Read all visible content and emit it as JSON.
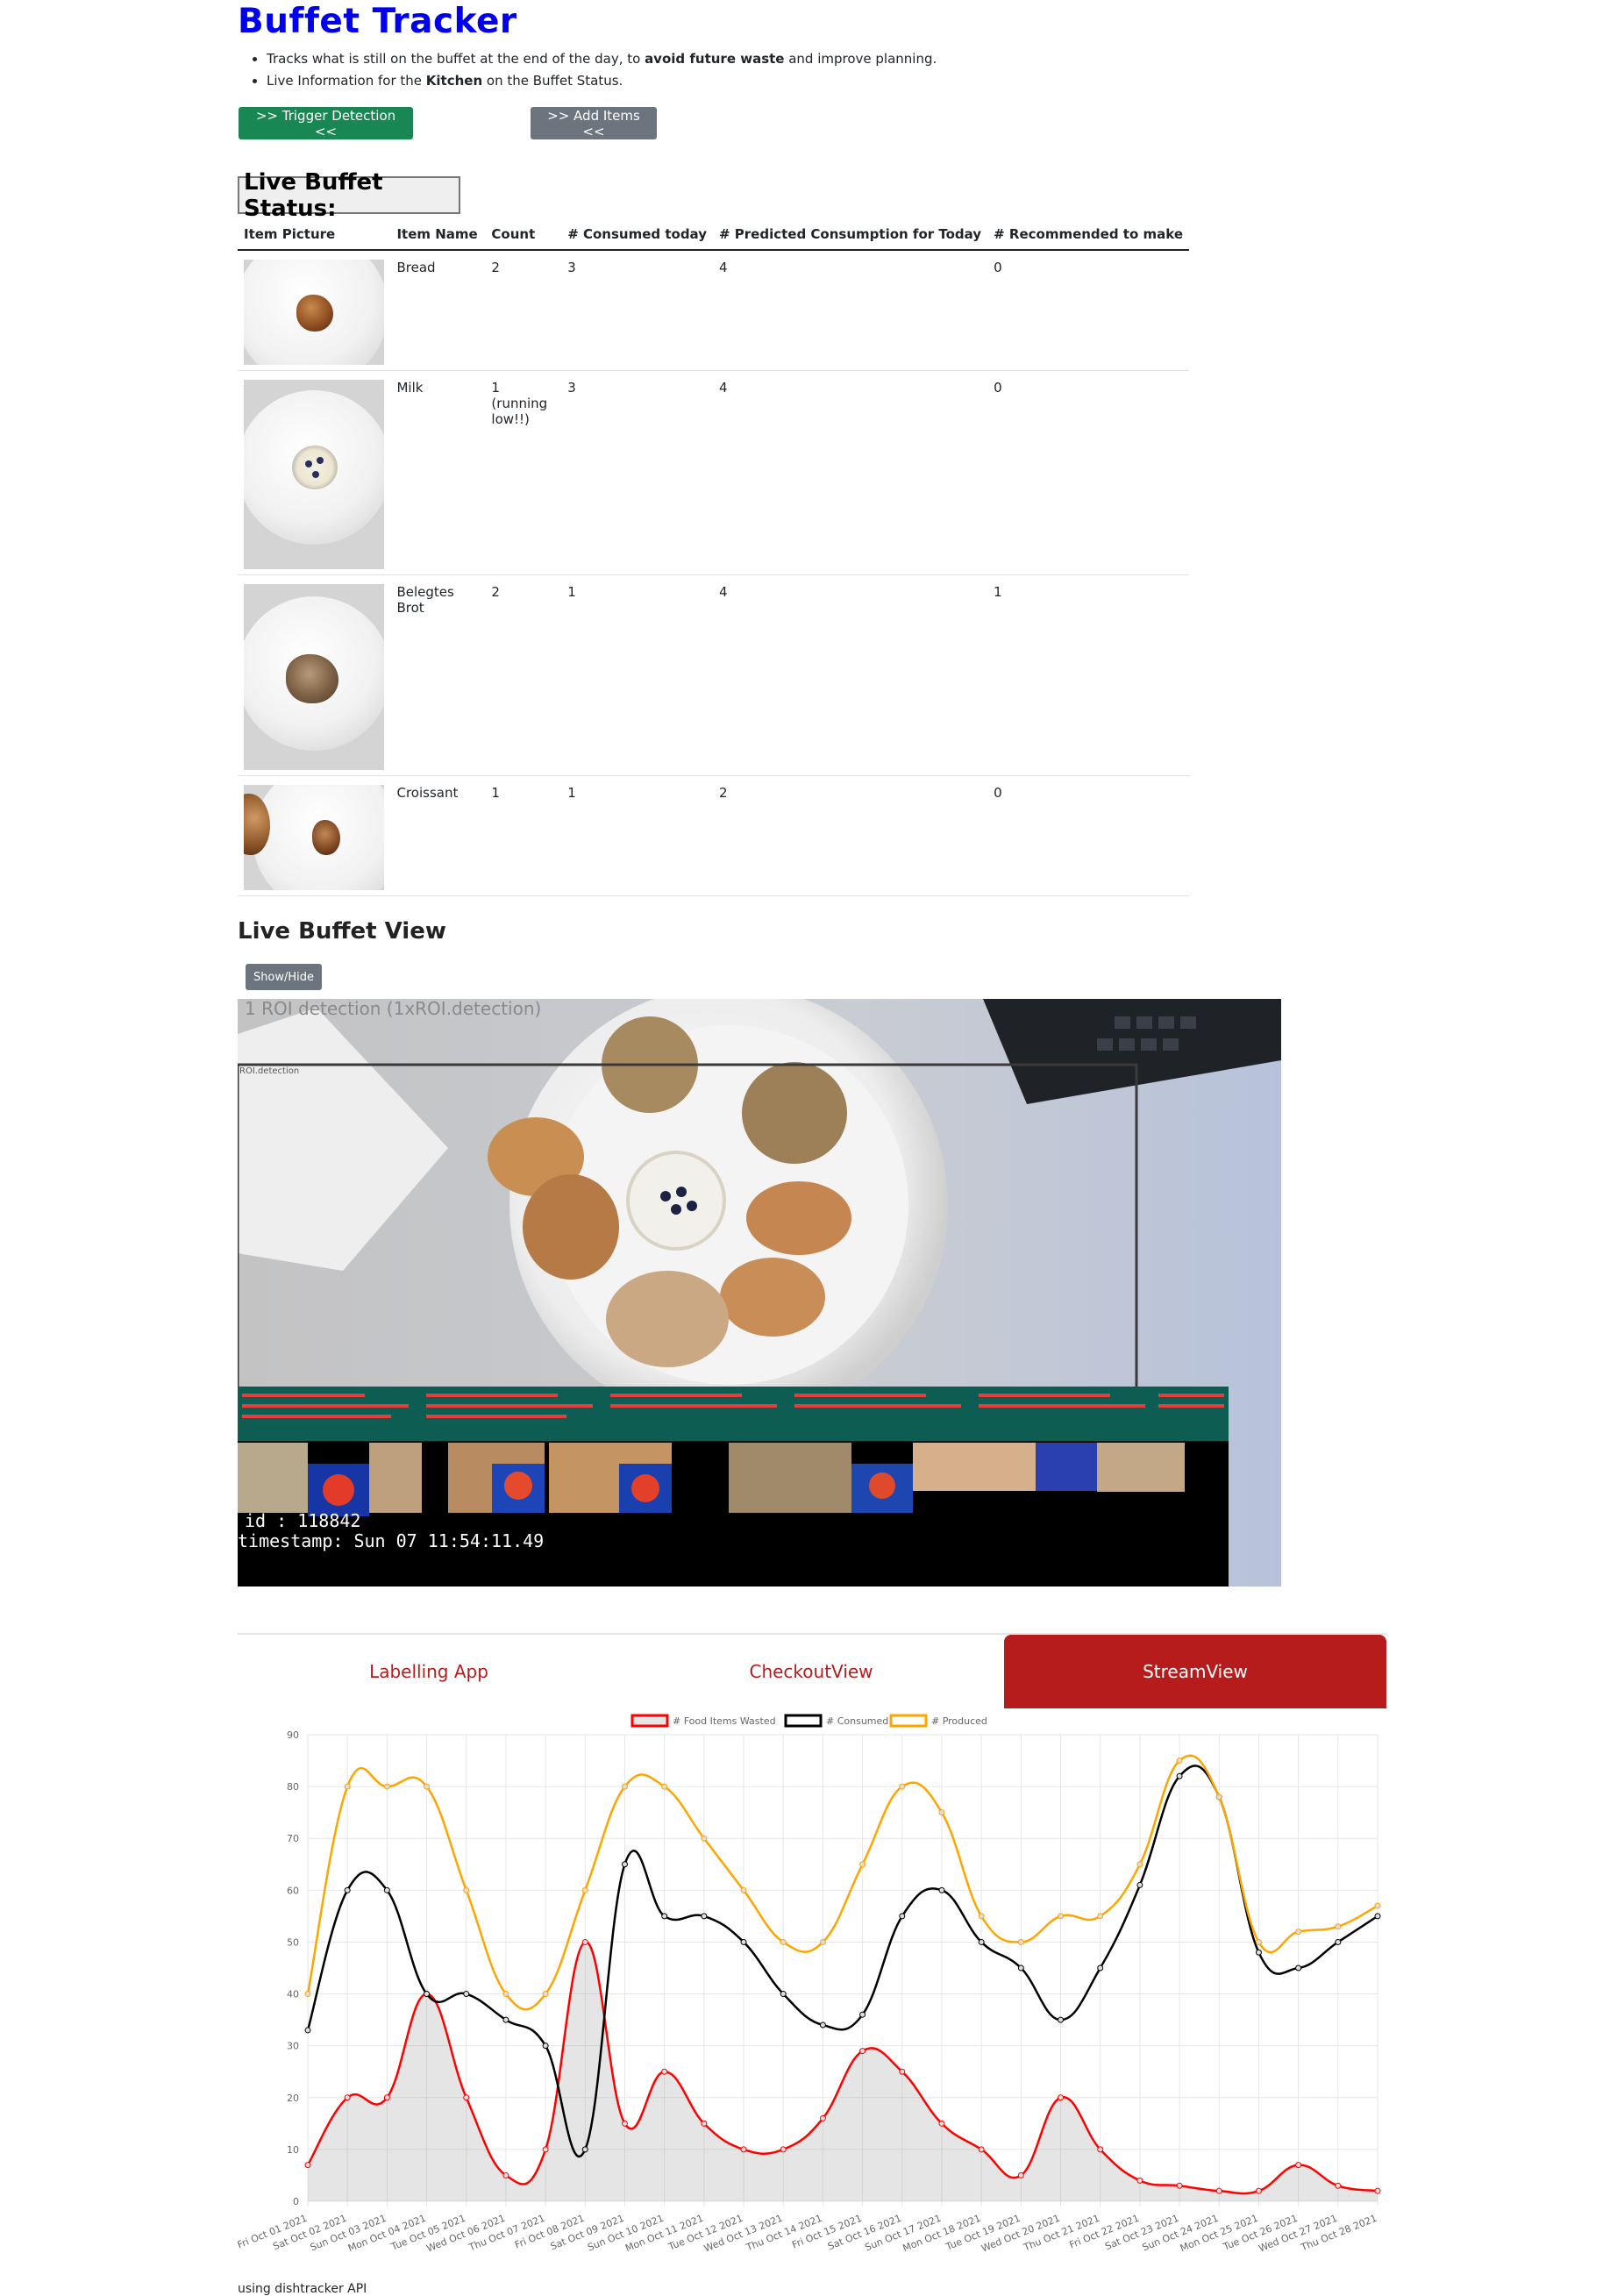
{
  "header": {
    "title": "Buffet Tracker",
    "bullets": [
      {
        "pre": "Tracks what is still on the buffet at the end of the day, to ",
        "bold": "avoid future waste",
        "post": " and improve planning."
      },
      {
        "pre": "Live Information for the ",
        "bold": "Kitchen",
        "post": " on the Buffet Status."
      }
    ],
    "trigger_label": ">> Trigger Detection <<",
    "add_label": ">> Add Items <<"
  },
  "status": {
    "heading": "Live Buffet Status:",
    "columns": [
      "Item Picture",
      "Item Name",
      "Count",
      "# Consumed today",
      "# Predicted Consumption for Today",
      "# Recommended to make"
    ],
    "rows": [
      {
        "name": "Bread",
        "count": "2",
        "consumed": "3",
        "predicted": "4",
        "recommended": "0"
      },
      {
        "name": "Milk",
        "count": "1 (running low!!)",
        "consumed": "3",
        "predicted": "4",
        "recommended": "0"
      },
      {
        "name": "Belegtes Brot",
        "count": "2",
        "consumed": "1",
        "predicted": "4",
        "recommended": "1"
      },
      {
        "name": "Croissant",
        "count": "1",
        "consumed": "1",
        "predicted": "2",
        "recommended": "0"
      }
    ]
  },
  "live_view": {
    "title": "Live Buffet View",
    "toggle_label": "Show/Hide",
    "overlay_top": "1 ROI detection  (1xROI.detection)",
    "roi_label": "ROI.detection",
    "id_text": "id    : 118842",
    "timestamp_text": "timestamp: Sun 07 11:54:11.49"
  },
  "tabs": {
    "items": [
      "Labelling App",
      "CheckoutView",
      "StreamView"
    ],
    "active": 2
  },
  "chart_data": {
    "type": "line",
    "categories": [
      "Fri Oct 01 2021",
      "Sat Oct 02 2021",
      "Sun Oct 03 2021",
      "Mon Oct 04 2021",
      "Tue Oct 05 2021",
      "Wed Oct 06 2021",
      "Thu Oct 07 2021",
      "Fri Oct 08 2021",
      "Sat Oct 09 2021",
      "Sun Oct 10 2021",
      "Mon Oct 11 2021",
      "Tue Oct 12 2021",
      "Wed Oct 13 2021",
      "Thu Oct 14 2021",
      "Fri Oct 15 2021",
      "Sat Oct 16 2021",
      "Sun Oct 17 2021",
      "Mon Oct 18 2021",
      "Tue Oct 19 2021",
      "Wed Oct 20 2021",
      "Thu Oct 21 2021",
      "Fri Oct 22 2021",
      "Sat Oct 23 2021",
      "Sun Oct 24 2021",
      "Mon Oct 25 2021",
      "Tue Oct 26 2021",
      "Wed Oct 27 2021",
      "Thu Oct 28 2021"
    ],
    "series": [
      {
        "name": "# Food Items Wasted",
        "color": "#ff0000",
        "fill": true,
        "values": [
          7,
          20,
          20,
          40,
          20,
          5,
          10,
          50,
          15,
          25,
          15,
          10,
          10,
          16,
          29,
          25,
          15,
          10,
          5,
          20,
          10,
          4,
          3,
          2,
          2,
          7,
          3,
          2
        ]
      },
      {
        "name": "# Consumed",
        "color": "#000000",
        "fill": false,
        "values": [
          33,
          60,
          60,
          40,
          40,
          35,
          30,
          10,
          65,
          55,
          55,
          50,
          40,
          34,
          36,
          55,
          60,
          50,
          45,
          35,
          45,
          61,
          82,
          78,
          48,
          45,
          50,
          55
        ]
      },
      {
        "name": "# Produced",
        "color": "#ffa500",
        "fill": false,
        "values": [
          40,
          80,
          80,
          80,
          60,
          40,
          40,
          60,
          80,
          80,
          70,
          60,
          50,
          50,
          65,
          80,
          75,
          55,
          50,
          55,
          55,
          65,
          85,
          78,
          50,
          52,
          53,
          57
        ]
      }
    ],
    "ylim": [
      0,
      90
    ],
    "yticks": [
      0,
      10,
      20,
      30,
      40,
      50,
      60,
      70,
      80,
      90
    ],
    "legend": "top",
    "grid": true
  },
  "footer": {
    "text": "using dishtracker API"
  }
}
